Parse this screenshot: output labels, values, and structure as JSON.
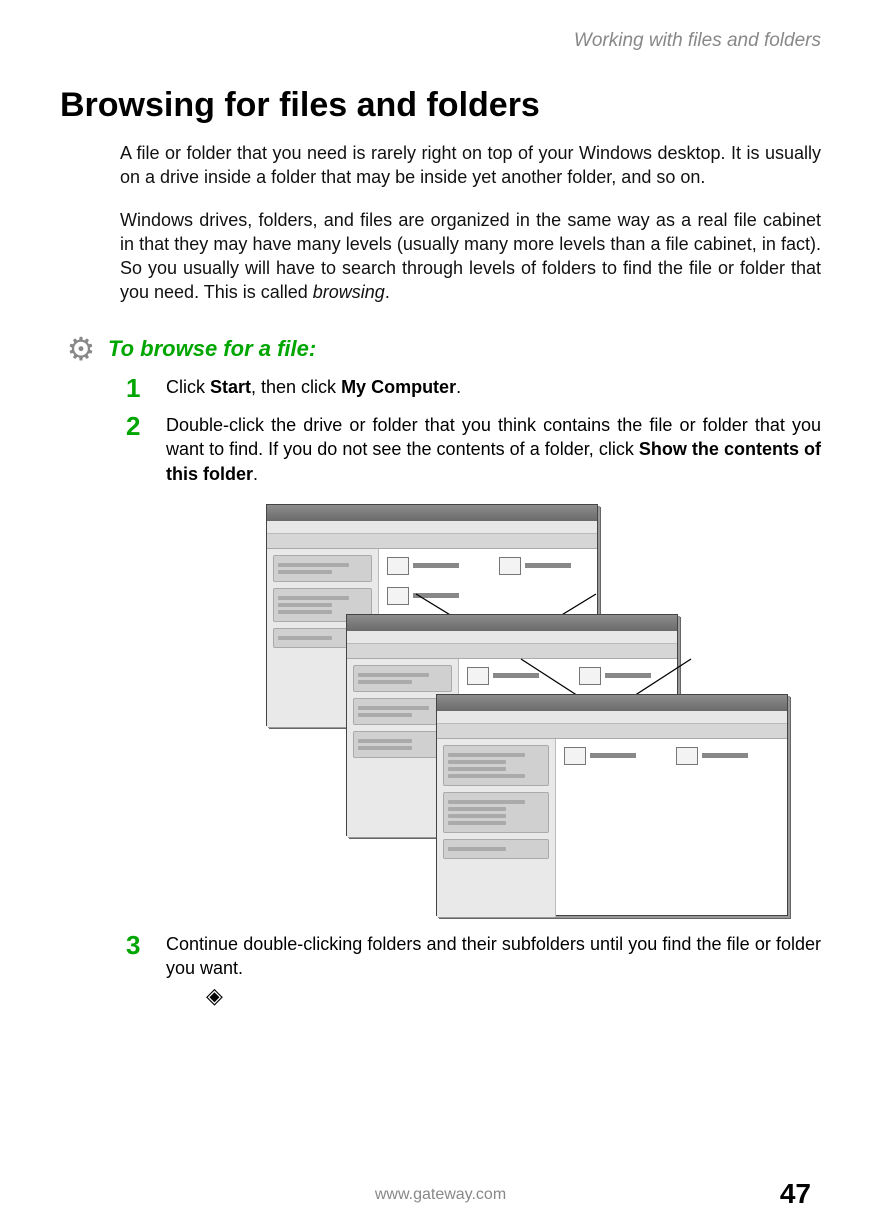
{
  "header": {
    "running_title": "Working with files and folders"
  },
  "title": "Browsing for files and folders",
  "paragraphs": {
    "p1": "A file or folder that you need is rarely right on top of your Windows desktop. It is usually on a drive inside a folder that may be inside yet another folder, and so on.",
    "p2_a": "Windows drives, folders, and files are organized in the same way as a real file cabinet in that they may have many levels (usually many more levels than a file cabinet, in fact). So you usually will have to search through levels of folders to find the file or folder that you need. This is called ",
    "p2_b": "browsing",
    "p2_c": "."
  },
  "procedure": {
    "title": "To browse for a file:",
    "steps": {
      "s1_a": "Click ",
      "s1_b": "Start",
      "s1_c": ", then click ",
      "s1_d": "My Computer",
      "s1_e": ".",
      "s2_a": "Double-click the drive or folder that you think contains the file or folder that you want to find. If you do not see the contents of a folder, click ",
      "s2_b": "Show the contents of this folder",
      "s2_c": ".",
      "s3": "Continue double-clicking folders and their subfolders until you find the file or folder you want."
    }
  },
  "footer": {
    "url": "www.gateway.com",
    "page": "47"
  }
}
